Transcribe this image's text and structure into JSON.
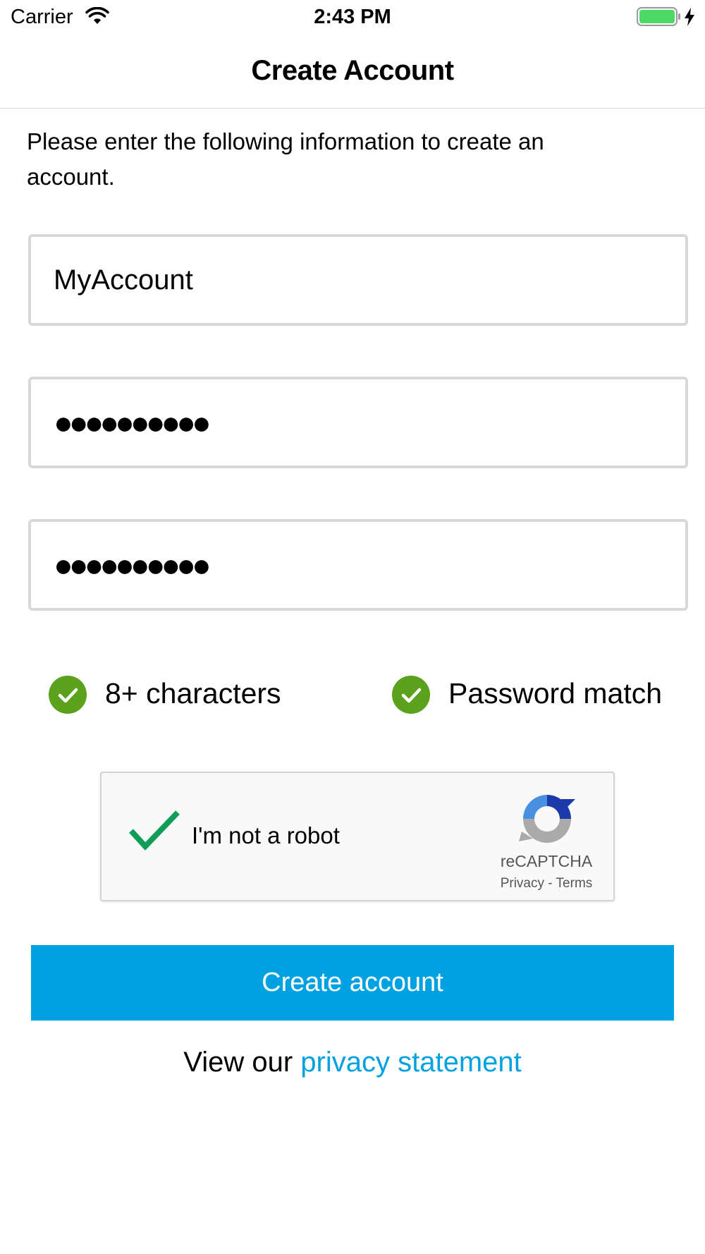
{
  "status_bar": {
    "carrier": "Carrier",
    "time": "2:43 PM"
  },
  "nav": {
    "title": "Create Account"
  },
  "form": {
    "intro": "Please enter the following information to create an account.",
    "username": "MyAccount",
    "password_masked": "●●●●●●●●●●",
    "confirm_password_masked": "●●●●●●●●●●"
  },
  "validation": {
    "length": "8+ characters",
    "match": "Password match"
  },
  "captcha": {
    "label": "I'm not a robot",
    "brand": "reCAPTCHA",
    "privacy_link": "Privacy",
    "separator": "-",
    "terms_link": "Terms"
  },
  "actions": {
    "create": "Create account"
  },
  "footer": {
    "prefix": "View our",
    "link": "privacy statement"
  },
  "colors": {
    "accent": "#00a1e0",
    "check_green": "#5aa21c",
    "battery_green": "#4cd964"
  }
}
